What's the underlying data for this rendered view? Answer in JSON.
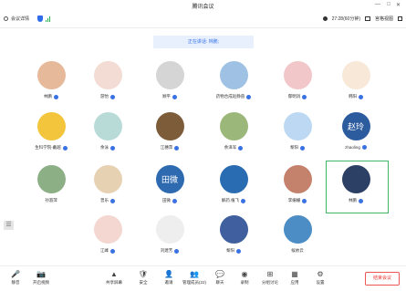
{
  "window": {
    "title": "腾讯会议",
    "controls": [
      "—",
      "□",
      "✕"
    ]
  },
  "topbar": {
    "info_label": "会议详情",
    "timer": "27:28(60分钟)",
    "view_label": "宫格视图"
  },
  "speaker": {
    "label": "正在讲话: 林鹏;"
  },
  "participants": [
    {
      "name": "林鹏",
      "color": "#e7b99b",
      "badge": false,
      "host": true
    },
    {
      "name": "游怡",
      "color": "#f3dcd3",
      "badge": true,
      "host": false
    },
    {
      "name": "顾平",
      "color": "#d5d5d5",
      "badge": true,
      "host": false
    },
    {
      "name": "药物合成赵静茵",
      "color": "#9fc2e4",
      "badge": true,
      "host": false
    },
    {
      "name": "鄢明涓",
      "color": "#f1c7c9",
      "badge": true,
      "host": false
    },
    {
      "name": "韩阳",
      "color": "#f8e8d8",
      "badge": true,
      "host": false
    },
    {
      "name": "生科学院-戴越",
      "color": "#f2c53c",
      "badge": true,
      "host": false
    },
    {
      "name": "余泳",
      "color": "#b9dbd8",
      "badge": true,
      "host": false
    },
    {
      "name": "江穗萍",
      "color": "#7d5c3a",
      "badge": true,
      "host": false
    },
    {
      "name": "余泽军",
      "color": "#9bb87a",
      "badge": true,
      "host": false
    },
    {
      "name": "黎阳",
      "color": "#bcd8f3",
      "badge": true,
      "host": false
    },
    {
      "name": "zhaoling",
      "color": "#2d5c9e",
      "badge": true,
      "host": false,
      "text": "赵玲"
    },
    {
      "name": "孙淑萍",
      "color": "#8caf85",
      "badge": false,
      "host": false
    },
    {
      "name": "曾乐",
      "color": "#e7d1b3",
      "badge": true,
      "host": false
    },
    {
      "name": "田微",
      "color": "#2d6ab0",
      "badge": true,
      "host": false,
      "text": "田微"
    },
    {
      "name": "解药.植飞",
      "color": "#2a6cb2",
      "badge": true,
      "host": false
    },
    {
      "name": "李姗姗",
      "color": "#c4826c",
      "badge": true,
      "host": false
    },
    {
      "name": "林鹏",
      "color": "#2c3f64",
      "badge": false,
      "host": true
    },
    {
      "name": "江峰",
      "color": "#f3d7d0",
      "badge": true,
      "host": false
    },
    {
      "name": "刘建芳",
      "color": "#eeeeee",
      "badge": true,
      "host": false
    },
    {
      "name": "黎阳",
      "color": "#3f5f9e",
      "badge": true,
      "host": false
    },
    {
      "name": "候依云",
      "color": "#4b8dc4",
      "badge": false,
      "host": false
    }
  ],
  "side_toggle": "☰",
  "bottombar": {
    "items": [
      {
        "name": "mic",
        "label": "静音",
        "icon": "🎤"
      },
      {
        "name": "video",
        "label": "开启视频",
        "icon": "📷"
      },
      {
        "name": "share",
        "label": "共享屏幕",
        "icon": "▲"
      },
      {
        "name": "security",
        "label": "安全",
        "icon": "🛡"
      },
      {
        "name": "invite",
        "label": "邀请",
        "icon": "👤"
      },
      {
        "name": "members",
        "label": "管理成员(22)",
        "icon": "👥"
      },
      {
        "name": "chat",
        "label": "聊天",
        "icon": "💬"
      },
      {
        "name": "record",
        "label": "录制",
        "icon": "◉"
      },
      {
        "name": "breakout",
        "label": "分组讨论",
        "icon": "⊞"
      },
      {
        "name": "apps",
        "label": "应用",
        "icon": "▦"
      },
      {
        "name": "settings",
        "label": "设置",
        "icon": "⚙"
      }
    ],
    "leave_label": "结束会议"
  },
  "colors": {
    "accent": "#3a72e4",
    "highlight": "#41b56a",
    "leave": "#e33333"
  }
}
